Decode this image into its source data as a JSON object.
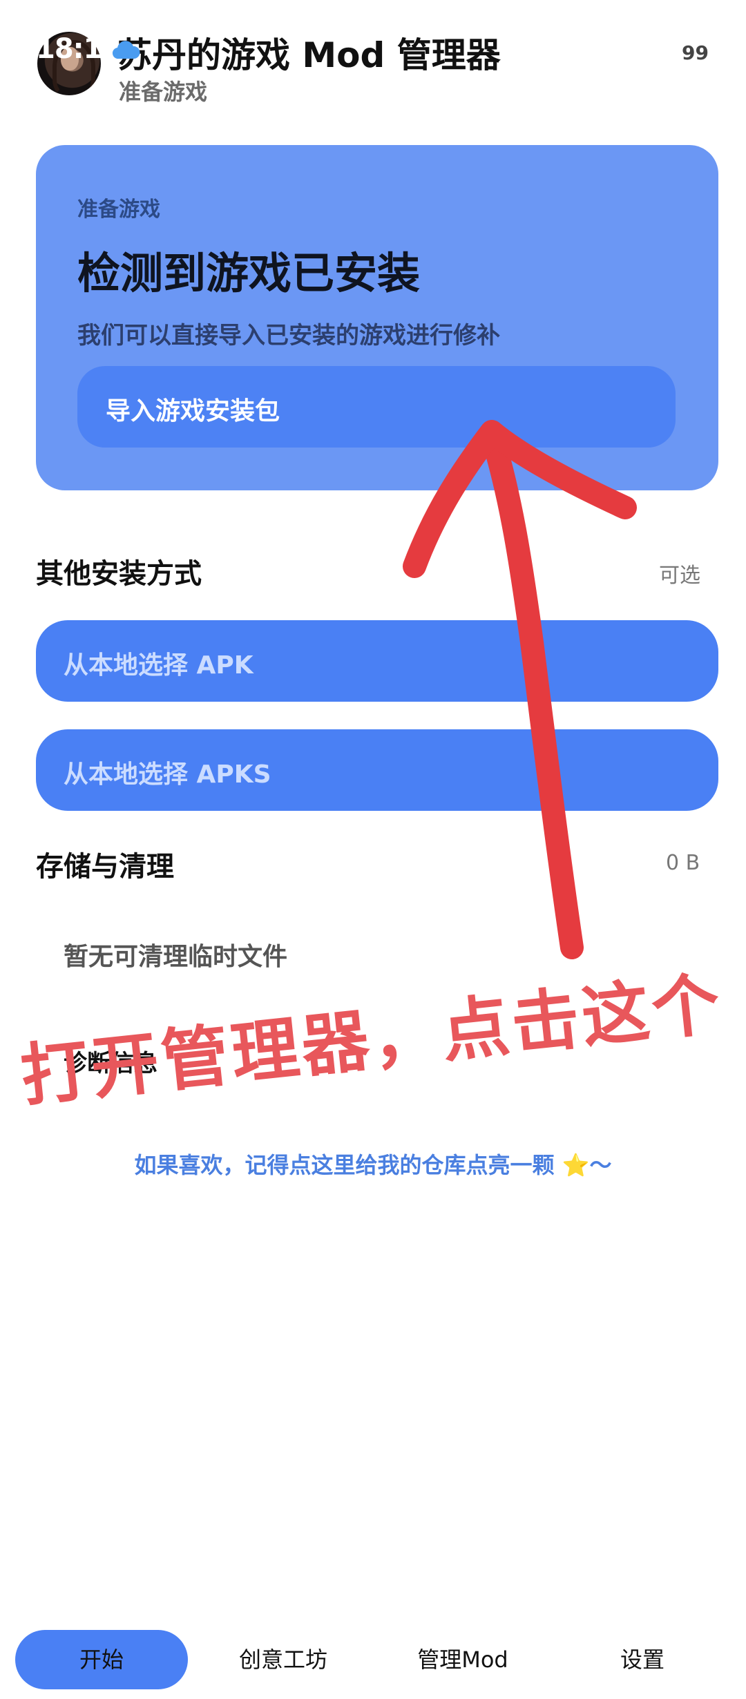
{
  "status_bar": {
    "time": "18:19",
    "battery": "99"
  },
  "header": {
    "title": "苏丹的游戏 Mod 管理器",
    "subtitle": "准备游戏"
  },
  "hero_card": {
    "eyebrow": "准备游戏",
    "title": "检测到游戏已安装",
    "description": "我们可以直接导入已安装的游戏进行修补",
    "button_label": "导入游戏安装包"
  },
  "other_install": {
    "title": "其他安装方式",
    "meta": "可选",
    "buttons": [
      "从本地选择 APK",
      "从本地选择 APKS"
    ]
  },
  "storage": {
    "title": "存储与清理",
    "size": "0 B",
    "empty_text": "暂无可清理临时文件"
  },
  "diagnostics": {
    "title": "诊断信息"
  },
  "repo_link": {
    "text": "如果喜欢，记得点这里给我的仓库点亮一颗",
    "emoji": "⭐",
    "tail": "～"
  },
  "annotation": {
    "text": "打开管理器，点击这个",
    "color": "#e53b3f"
  },
  "bottom_nav": {
    "items": [
      "开始",
      "创意工坊",
      "管理Mod",
      "设置"
    ],
    "active_index": 0
  },
  "colors": {
    "accent": "#4a80f4",
    "card": "#6b97f4"
  }
}
